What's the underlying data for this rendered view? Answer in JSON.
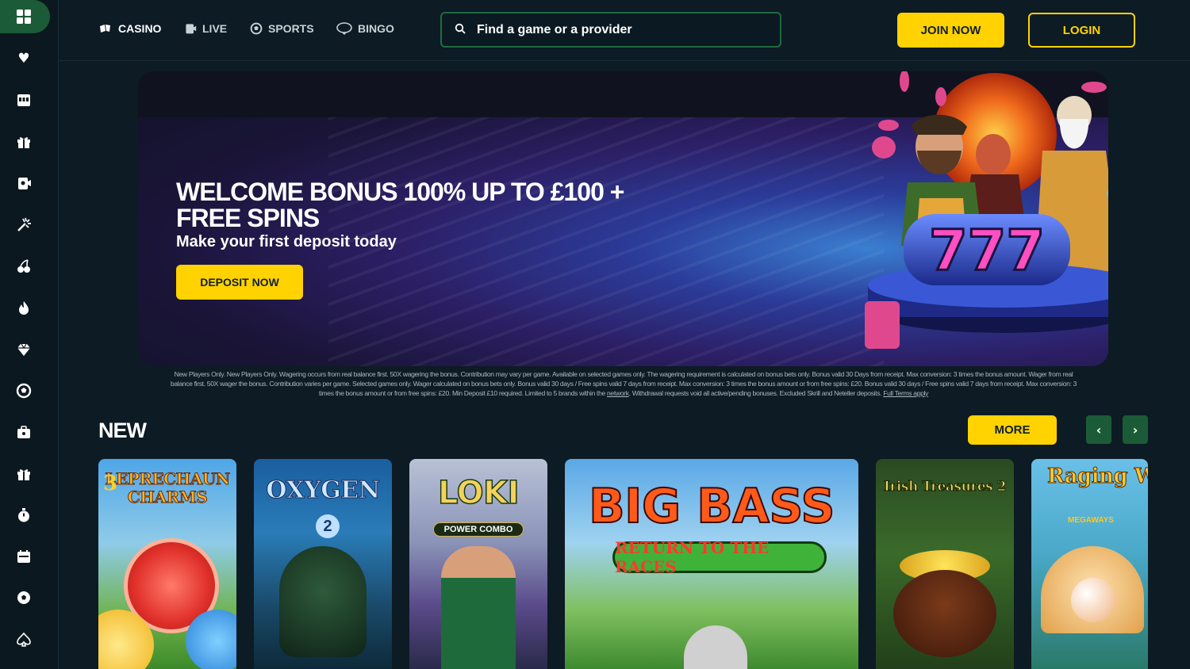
{
  "sidebar": {
    "icons": [
      "grid-icon",
      "heart-icon",
      "slot-machine-icon",
      "gift-icon",
      "live-casino-icon",
      "sparkler-icon",
      "cherry-icon",
      "flame-icon",
      "diamond-icon",
      "soccer-ball-icon",
      "briefcase-icon",
      "gift-box-icon",
      "stopwatch-icon",
      "calendar-icon",
      "football-icon",
      "spade-icon"
    ]
  },
  "nav": {
    "casino": "CASINO",
    "live": "LIVE",
    "sports": "SPORTS",
    "bingo": "BINGO"
  },
  "search": {
    "placeholder": "Find a game or a provider"
  },
  "header": {
    "join_label": "JOIN NOW",
    "login_label": "LOGIN"
  },
  "hero": {
    "title": "WELCOME BONUS 100% UP TO £100 + FREE SPINS",
    "subtitle": "Make your first deposit today",
    "cta": "DEPOSIT NOW",
    "reels": "777"
  },
  "terms": {
    "text": "New Players Only. New Players Only. Wagering occurs from real balance first. 50X wagering the bonus. Contribution may vary per game. Available on selected games only. The wagering requirement is calculated on bonus bets only. Bonus valid 30 Days from receipt. Max conversion: 3 times the bonus amount. Wager from real balance first. 50X wager the bonus. Contribution varies per game. Selected games only. Wager calculated on bonus bets only. Bonus valid 30 days / Free spins valid 7 days from receipt. Max conversion: 3 times the bonus amount or from free spins: £20. Bonus valid 30 days / Free spins valid 7 days from receipt. Max conversion: 3 times the bonus amount or from free spins: £20. Min Deposit £10 required. Limited to 5 brands within the",
    "network_link": "network",
    "text_after": ". Withdrawal requests void all active/pending bonuses. Excluded Skrill and Neteller deposits.",
    "full_terms_link": "Full Terms apply"
  },
  "new_section": {
    "title": "NEW",
    "more_label": "MORE",
    "prev": "‹",
    "next": "›",
    "games": [
      {
        "title": "LEPRECHAUN CHARMS",
        "number": "3"
      },
      {
        "title": "OXYGEN",
        "number": "2"
      },
      {
        "title": "LOKI",
        "tagline": "POWER COMBO"
      },
      {
        "title": "BIG BASS",
        "tagline": "RETURN TO THE RACES"
      },
      {
        "title": "Irish Treasures 2"
      },
      {
        "title": "Raging Waterfall",
        "tagline": "MEGAWAYS"
      }
    ]
  },
  "colors": {
    "accent": "#ffd200",
    "green": "#1c5b37",
    "bg": "#0d1b24"
  }
}
